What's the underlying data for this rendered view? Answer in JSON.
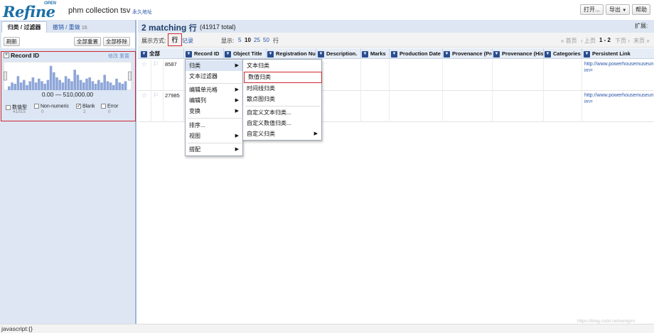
{
  "app": {
    "logo_text": "Refine",
    "logo_badge": "OPEN",
    "project_name": "phm collection tsv",
    "permalink": "永久地址",
    "buttons": {
      "open": "打开...",
      "export": "导出",
      "export_arrow": "▼",
      "help": "帮助"
    }
  },
  "left_panel": {
    "tab_facets": "归类 / 过滤器",
    "tab_undo": "撤销 / 重做",
    "tab_undo_count": "16",
    "toolbar": {
      "refresh": "刷新",
      "reset_all": "全部重置",
      "remove_all": "全部移除"
    },
    "facet": {
      "close": "×",
      "title": "Record ID",
      "change": "修改",
      "reset": "重置",
      "range_text": "0.00 — 510,000.00",
      "histogram_bins": [
        0.15,
        0.3,
        0.25,
        0.55,
        0.3,
        0.4,
        0.2,
        0.35,
        0.5,
        0.3,
        0.45,
        0.35,
        0.25,
        0.4,
        0.95,
        0.7,
        0.5,
        0.4,
        0.3,
        0.55,
        0.45,
        0.35,
        0.8,
        0.6,
        0.4,
        0.3,
        0.45,
        0.5,
        0.35,
        0.25,
        0.4,
        0.3,
        0.6,
        0.35,
        0.3,
        0.2,
        0.45,
        0.3,
        0.25,
        0.35
      ],
      "histogram_color": "#8ea6d8",
      "checks": [
        {
          "label": "数值型",
          "count": "41915",
          "checked": false
        },
        {
          "label": "Non-numeric",
          "count": "0",
          "checked": false
        },
        {
          "label": "Blank",
          "count": "2",
          "checked": true
        },
        {
          "label": "Error",
          "count": "0",
          "checked": false
        }
      ]
    }
  },
  "summary": {
    "matching": "2 matching",
    "rows_word": "行",
    "total": "(41917 total)",
    "extensions": "扩展:"
  },
  "view_bar": {
    "show_as": "展示方式:",
    "rows": "行",
    "records": "记录",
    "display": "显示:",
    "page_sizes": [
      "5",
      "10",
      "25",
      "50"
    ],
    "page_sizes_suffix": "行",
    "nav": {
      "first": "« 首页",
      "prev": "‹ 上页",
      "range": "1 - 2",
      "next": "下页 ›",
      "last": "末页 »"
    }
  },
  "columns": {
    "all": "全部",
    "headers": [
      "Record ID",
      "Object Title",
      "Registration Nur",
      "Description.",
      "Marks",
      "Production Date",
      "Provenance (Pro",
      "Provenance (His",
      "Categories",
      "Persistent Link"
    ]
  },
  "rows": [
    {
      "record_id": "8587",
      "link": "http://www.powerhousemuseum.com/collection/database/?irn="
    },
    {
      "record_id": "27985",
      "link": "http://www.powerhousemuseum.com/collection/database/?irn="
    }
  ],
  "column_menu": {
    "items": [
      {
        "label": "归类",
        "submenu": true
      },
      {
        "label": "文本过滤器",
        "submenu": false
      },
      {
        "label": "编辑单元格",
        "submenu": true
      },
      {
        "label": "编辑列",
        "submenu": true
      },
      {
        "label": "变换",
        "submenu": true
      },
      {
        "label": "排序...",
        "submenu": false
      },
      {
        "label": "视图",
        "submenu": true
      },
      {
        "label": "搭配",
        "submenu": true
      }
    ]
  },
  "facet_submenu": {
    "items": [
      {
        "label": "文本归类",
        "submenu": false
      },
      {
        "label": "数值归类",
        "submenu": false
      },
      {
        "label": "时间线归类",
        "submenu": false
      },
      {
        "label": "散点图归类",
        "submenu": false
      },
      {
        "label": "自定义文本归类...",
        "submenu": false
      },
      {
        "label": "自定义数值归类...",
        "submenu": false
      },
      {
        "label": "自定义归类",
        "submenu": true
      }
    ]
  },
  "status_bar": {
    "text": "javascript:{}"
  },
  "watermark": "https://blog.csdn.net/wmgnn"
}
